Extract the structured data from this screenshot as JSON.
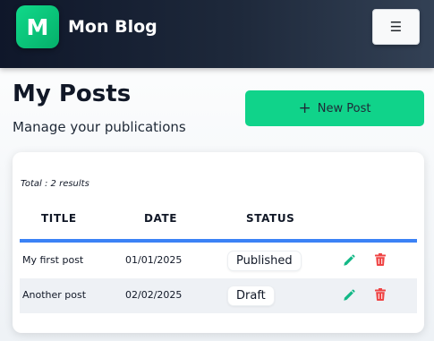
{
  "navbar": {
    "logo_letter": "M",
    "brand": "Mon Blog",
    "menu_icon": "hamburger-icon",
    "menu_glyph": "☰"
  },
  "header": {
    "title": "My Posts",
    "subtitle": "Manage your publications",
    "new_post_icon": "plus-icon",
    "new_post_glyph": "+",
    "new_post_label": "New Post"
  },
  "table": {
    "total": "Total : 2 results",
    "columns": [
      "TITLE",
      "DATE",
      "STATUS"
    ],
    "rows": [
      {
        "title": "My first post",
        "date": "01/01/2025",
        "status": "Published"
      },
      {
        "title": "Another post",
        "date": "02/02/2025",
        "status": "Draft"
      }
    ],
    "row_actions": [
      "edit-icon",
      "delete-icon"
    ]
  },
  "colors": {
    "accent_green": "#10d38a",
    "header_underline": "#3b82f6",
    "edit_icon": "#12b886",
    "delete_icon": "#ef4444",
    "navbar_dark": "#0f172a"
  }
}
